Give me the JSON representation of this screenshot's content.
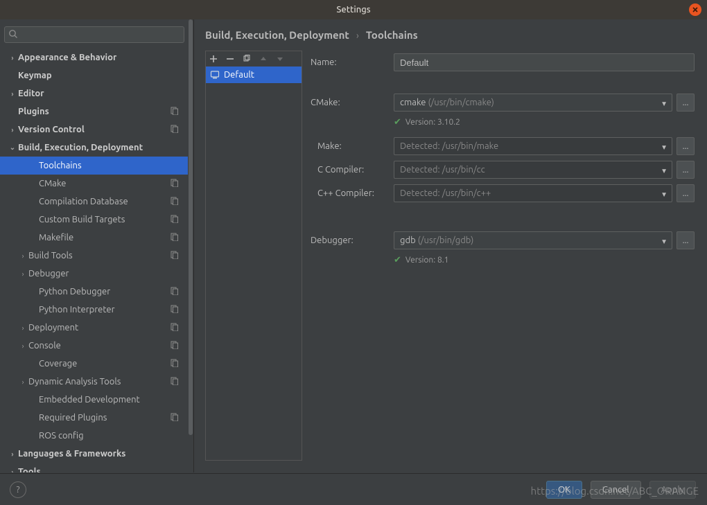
{
  "window": {
    "title": "Settings"
  },
  "search": {
    "placeholder": ""
  },
  "sidebar": {
    "items": [
      {
        "label": "Appearance & Behavior",
        "bold": true,
        "expand": "›"
      },
      {
        "label": "Keymap",
        "bold": true
      },
      {
        "label": "Editor",
        "bold": true,
        "expand": "›"
      },
      {
        "label": "Plugins",
        "bold": true,
        "proj": true
      },
      {
        "label": "Version Control",
        "bold": true,
        "expand": "›",
        "proj": true
      },
      {
        "label": "Build, Execution, Deployment",
        "bold": true,
        "expand": "⌄"
      },
      {
        "label": "Toolchains",
        "child": true,
        "sel": true
      },
      {
        "label": "CMake",
        "child": true,
        "proj": true
      },
      {
        "label": "Compilation Database",
        "child": true,
        "proj": true
      },
      {
        "label": "Custom Build Targets",
        "child": true,
        "proj": true
      },
      {
        "label": "Makefile",
        "child": true,
        "proj": true
      },
      {
        "label": "Build Tools",
        "child2": true,
        "expand": "›",
        "proj": true
      },
      {
        "label": "Debugger",
        "child2": true,
        "expand": "›"
      },
      {
        "label": "Python Debugger",
        "child": true,
        "proj": true
      },
      {
        "label": "Python Interpreter",
        "child": true,
        "proj": true
      },
      {
        "label": "Deployment",
        "child2": true,
        "expand": "›",
        "proj": true
      },
      {
        "label": "Console",
        "child2": true,
        "expand": "›",
        "proj": true
      },
      {
        "label": "Coverage",
        "child": true,
        "proj": true
      },
      {
        "label": "Dynamic Analysis Tools",
        "child2": true,
        "expand": "›",
        "proj": true
      },
      {
        "label": "Embedded Development",
        "child": true
      },
      {
        "label": "Required Plugins",
        "child": true,
        "proj": true
      },
      {
        "label": "ROS config",
        "child": true
      },
      {
        "label": "Languages & Frameworks",
        "bold": true,
        "expand": "›"
      },
      {
        "label": "Tools",
        "bold": true,
        "expand": "›"
      }
    ]
  },
  "breadcrumb": {
    "parent": "Build, Execution, Deployment",
    "current": "Toolchains"
  },
  "toolchains": {
    "selected": "Default"
  },
  "form": {
    "name_label": "Name:",
    "name_value": "Default",
    "cmake_label": "CMake:",
    "cmake_value": "cmake",
    "cmake_hint": "(/usr/bin/cmake)",
    "cmake_version": "Version: 3.10.2",
    "make_label": "Make:",
    "make_value": "Detected: /usr/bin/make",
    "cc_label": "C Compiler:",
    "cc_value": "Detected: /usr/bin/cc",
    "cxx_label": "C++ Compiler:",
    "cxx_value": "Detected: /usr/bin/c++",
    "debugger_label": "Debugger:",
    "debugger_value": "gdb",
    "debugger_hint": "(/usr/bin/gdb)",
    "debugger_version": "Version: 8.1"
  },
  "buttons": {
    "ok": "OK",
    "cancel": "Cancel",
    "apply": "Apply",
    "browse": "..."
  },
  "watermark": "https://blog.csdn.net/ABC_ORANGE"
}
